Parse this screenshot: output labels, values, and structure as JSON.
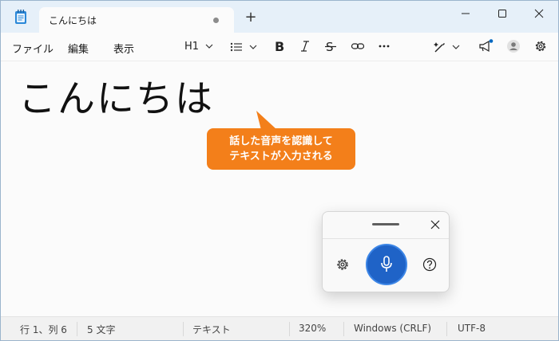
{
  "tab": {
    "title": "こんにちは"
  },
  "menu": {
    "file": "ファイル",
    "edit": "編集",
    "view": "表示"
  },
  "format": {
    "heading": "H1"
  },
  "editor": {
    "content": "こんにちは"
  },
  "callout": {
    "line1": "話した音声を認識して",
    "line2": "テキストが入力される"
  },
  "status": {
    "position": "行 1、列 6",
    "chars": "5 文字",
    "format": "テキスト",
    "zoom": "320%",
    "line_ending": "Windows (CRLF)",
    "encoding": "UTF-8"
  },
  "colors": {
    "callout": "#f37f1a",
    "mic": "#1f63c7",
    "titlebar": "#e6f0f9",
    "notify_dot": "#0067c0"
  }
}
